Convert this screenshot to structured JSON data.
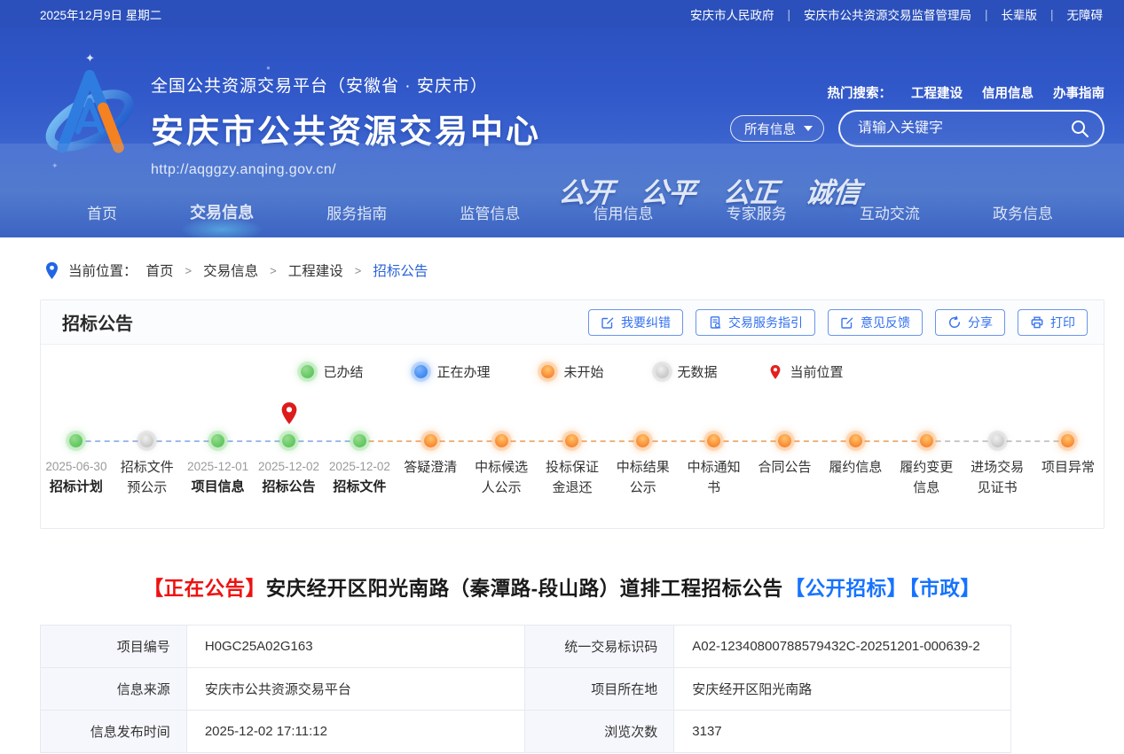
{
  "topbar": {
    "date": "2025年12月9日 星期二",
    "separator": "|",
    "links": [
      "安庆市人民政府",
      "安庆市公共资源交易监督管理局",
      "长辈版",
      "无障碍"
    ]
  },
  "header": {
    "platform_subtitle": "全国公共资源交易平台（安徽省 · 安庆市）",
    "site_title": "安庆市公共资源交易中心",
    "site_url": "http://aqggzy.anqing.gov.cn/",
    "hot_search_label": "热门搜索：",
    "hot_search_links": [
      "工程建设",
      "信用信息",
      "办事指南"
    ],
    "search_filter": "所有信息",
    "search_placeholder": "请输入关键字",
    "slogan": "公开 公平 公正 诚信"
  },
  "nav": {
    "items": [
      {
        "label": "首页",
        "active": false
      },
      {
        "label": "交易信息",
        "active": true
      },
      {
        "label": "服务指南",
        "active": false
      },
      {
        "label": "监管信息",
        "active": false
      },
      {
        "label": "信用信息",
        "active": false
      },
      {
        "label": "专家服务",
        "active": false
      },
      {
        "label": "互动交流",
        "active": false
      },
      {
        "label": "政务信息",
        "active": false
      }
    ]
  },
  "breadcrumb": {
    "label": "当前位置：",
    "separator": ">",
    "items": [
      "首页",
      "交易信息",
      "工程建设",
      "招标公告"
    ]
  },
  "panel": {
    "title": "招标公告",
    "buttons": [
      "我要纠错",
      "交易服务指引",
      "意见反馈",
      "分享",
      "打印"
    ]
  },
  "legend": [
    {
      "label": "已办结",
      "color": "#49bd49"
    },
    {
      "label": "正在办理",
      "color": "#2176ee"
    },
    {
      "label": "未开始",
      "color": "#f4701c"
    },
    {
      "label": "无数据",
      "color": "#b8b8b8"
    },
    {
      "label": "当前位置",
      "color": "#e3201f"
    }
  ],
  "timeline": {
    "steps": [
      {
        "date": "2025-06-30",
        "label": "招标计划",
        "status": "done",
        "current": false
      },
      {
        "date": "",
        "label": "招标文件预公示",
        "status": "no_data",
        "current": false
      },
      {
        "date": "2025-12-01",
        "label": "项目信息",
        "status": "done",
        "current": false
      },
      {
        "date": "2025-12-02",
        "label": "招标公告",
        "status": "done",
        "current": true
      },
      {
        "date": "2025-12-02",
        "label": "招标文件",
        "status": "done",
        "current": false
      },
      {
        "date": "",
        "label": "答疑澄清",
        "status": "not_started",
        "current": false
      },
      {
        "date": "",
        "label": "中标候选人公示",
        "status": "not_started",
        "current": false
      },
      {
        "date": "",
        "label": "投标保证金退还",
        "status": "not_started",
        "current": false
      },
      {
        "date": "",
        "label": "中标结果公示",
        "status": "not_started",
        "current": false
      },
      {
        "date": "",
        "label": "中标通知书",
        "status": "not_started",
        "current": false
      },
      {
        "date": "",
        "label": "合同公告",
        "status": "not_started",
        "current": false
      },
      {
        "date": "",
        "label": "履约信息",
        "status": "not_started",
        "current": false
      },
      {
        "date": "",
        "label": "履约变更信息",
        "status": "not_started",
        "current": false
      },
      {
        "date": "",
        "label": "进场交易见证书",
        "status": "no_data",
        "current": false
      },
      {
        "date": "",
        "label": "项目异常",
        "status": "not_started",
        "current": false
      }
    ]
  },
  "article": {
    "status_tag": "【正在公告】",
    "title": "安庆经开区阳光南路（秦潭路-段山路）道排工程招标公告",
    "tags": [
      "【公开招标】",
      "【市政】"
    ]
  },
  "info_table": {
    "rows": [
      {
        "label1": "项目编号",
        "value1": "H0GC25A02G163",
        "label2": "统一交易标识码",
        "value2": "A02-12340800788579432C-20251201-000639-2"
      },
      {
        "label1": "信息来源",
        "value1": "安庆市公共资源交易平台",
        "label2": "项目所在地",
        "value2": "安庆经开区阳光南路"
      },
      {
        "label1": "信息发布时间",
        "value1": "2025-12-02 17:11:12",
        "label2": "浏览次数",
        "value2": "3137"
      }
    ]
  }
}
